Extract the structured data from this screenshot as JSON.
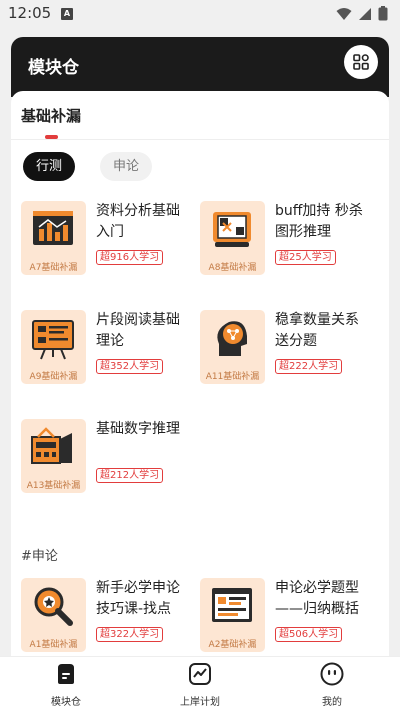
{
  "status_bar": {
    "time": "12:05",
    "notif_letter": "A"
  },
  "header": {
    "title": "模块仓"
  },
  "tabs": {
    "active": "基础补漏"
  },
  "filters": [
    {
      "label": "行测"
    },
    {
      "label": "申论"
    }
  ],
  "courses": [
    {
      "title": "资料分析基础入门",
      "tag": "A7基础补漏",
      "learners": "超916人学习",
      "icon": "chart-board-icon"
    },
    {
      "title": "buff加持 秒杀图形推理",
      "tag": "A8基础补漏",
      "learners": "超25人学习",
      "icon": "puzzle-scroll-icon"
    },
    {
      "title": "片段阅读基础理论",
      "tag": "A9基础补漏",
      "learners": "超352人学习",
      "icon": "presentation-board-icon"
    },
    {
      "title": "稳拿数量关系送分题",
      "tag": "A11基础补漏",
      "learners": "超222人学习",
      "icon": "head-network-icon"
    },
    {
      "title": "基础数字推理",
      "tag": "A13基础补漏",
      "learners": "超212人学习",
      "icon": "calculator-icon"
    }
  ],
  "section": {
    "heading": "#申论"
  },
  "essay_courses": [
    {
      "title": "新手必学申论技巧课-找点",
      "tag": "A1基础补漏",
      "learners": "超322人学习",
      "icon": "magnifier-target-icon"
    },
    {
      "title": "申论必学题型——归纳概括",
      "tag": "A2基础补漏",
      "learners": "超506人学习",
      "icon": "browser-window-icon"
    }
  ],
  "bottom_nav": [
    {
      "label": "模块仓",
      "icon": "module-icon"
    },
    {
      "label": "上岸计划",
      "icon": "plan-chart-icon"
    },
    {
      "label": "我的",
      "icon": "profile-face-icon"
    }
  ],
  "colors": {
    "accent": "#e23d3d",
    "header_bg": "#1b1b1b",
    "thumb_bg": "#fde6d3",
    "icon_orange": "#f08a2e"
  }
}
